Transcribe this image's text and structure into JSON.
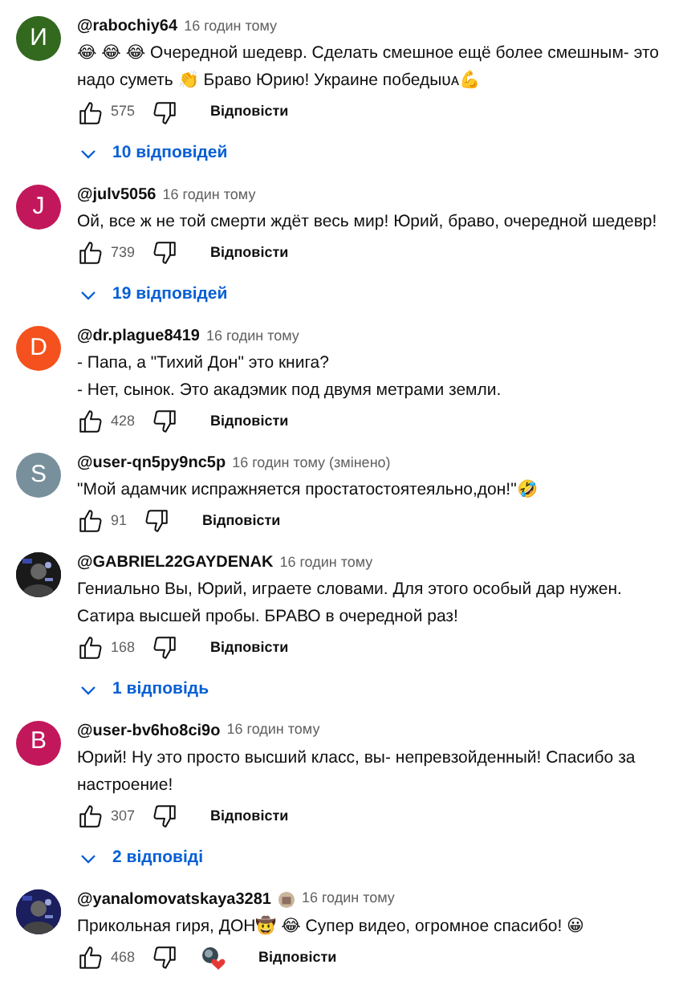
{
  "comments": [
    {
      "avatar": {
        "kind": "letter",
        "letter": "И",
        "color": "#33691e"
      },
      "author": "@rabochiy64",
      "time": "16 годин тому",
      "text": "😂 😂 😂 Очередной шедевр. Сделать смешное ещё более смешным- это надо суметь 👏 Браво Юрию! Украине победыᴜᴀ💪",
      "likes": "575",
      "reply_label": "Відповісти",
      "replies": "10 відповідей"
    },
    {
      "avatar": {
        "kind": "letter",
        "letter": "J",
        "color": "#c2185b"
      },
      "author": "@julv5056",
      "time": "16 годин тому",
      "text": "Ой, все ж не той смерти ждёт весь мир! Юрий, браво, очередной шедевр!",
      "likes": "739",
      "reply_label": "Відповісти",
      "replies": "19 відповідей"
    },
    {
      "avatar": {
        "kind": "letter",
        "letter": "D",
        "color": "#f4511e"
      },
      "author": "@dr.plague8419",
      "time": "16 годин тому",
      "text": "- Папа, а \"Тихий Дон\" это книга?\n- Нет, сынок. Это акадэмик под двумя метрами земли.",
      "likes": "428",
      "reply_label": "Відповісти"
    },
    {
      "avatar": {
        "kind": "letter",
        "letter": "S",
        "color": "#78909c"
      },
      "author": "@user-qn5py9nc5p",
      "time": "16 годин тому (змінено)",
      "text": "\"Мой адамчик испражняется простатостоятеяльно,дон!\"🤣",
      "likes": "91",
      "reply_label": "Відповісти"
    },
    {
      "author": "@GABRIEL22GAYDENAK",
      "time": "16 годин тому",
      "text": "Гениально Вы, Юрий, играете словами. Для этого особый дар нужен. Сатира высшей пробы. БРАВО в очередной раз!",
      "likes": "168",
      "reply_label": "Відповісти",
      "replies": "1 відповідь"
    },
    {
      "avatar": {
        "kind": "letter",
        "letter": "B",
        "color": "#c2185b"
      },
      "author": "@user-bv6ho8ci9o",
      "time": "16 годин тому",
      "text": "Юрий! Ну это просто высший класс, вы- непревзойденный! Спасибо за настроение!",
      "likes": "307",
      "reply_label": "Відповісти",
      "replies": "2 відповіді"
    },
    {
      "author": "@yanalomovatskaya3281",
      "badge": true,
      "time": "16 годин тому",
      "text": "Прикольная гиря, ДОН🤠 😂 Супер видео, огромное спасибо! 😀",
      "likes": "468",
      "creator_heart": true,
      "reply_label": "Відповісти"
    }
  ]
}
